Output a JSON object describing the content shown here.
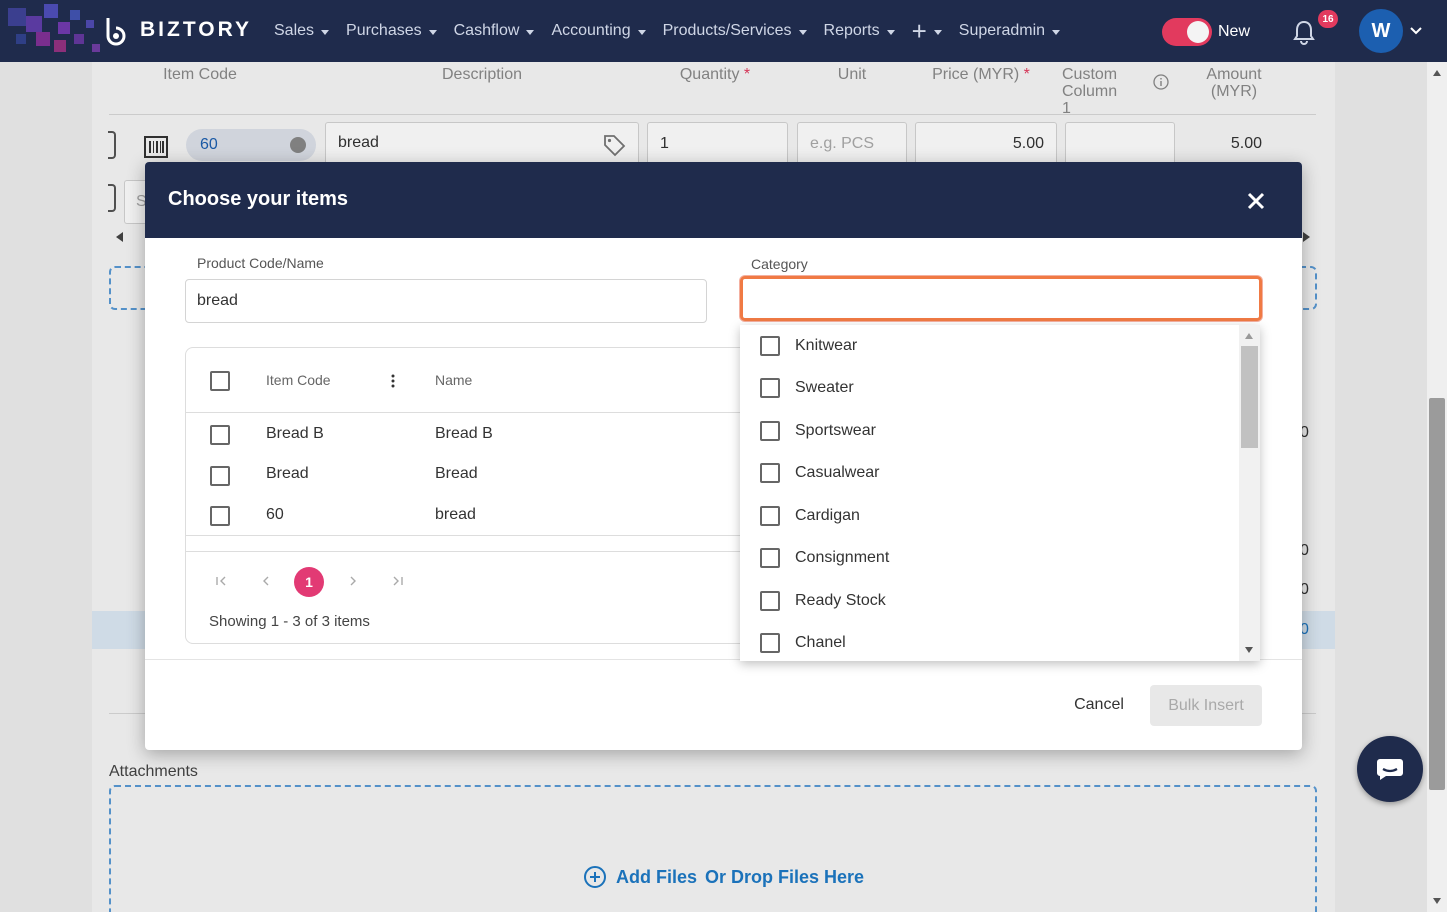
{
  "app": {
    "brand": "BIZTORY",
    "nav": [
      "Sales",
      "Purchases",
      "Cashflow",
      "Accounting",
      "Products/Services",
      "Reports"
    ],
    "superadmin": "Superadmin",
    "toggle_label": "New",
    "notification_count": "16",
    "avatar_initial": "W"
  },
  "background_table": {
    "headers": {
      "item_code": "Item Code",
      "description": "Description",
      "quantity": "Quantity",
      "unit": "Unit",
      "price": "Price (MYR)",
      "custom_column": "Custom Column 1",
      "amount": "Amount (MYR)"
    },
    "required_mark": "*",
    "row": {
      "item_code": "60",
      "description": "bread",
      "quantity": "1",
      "unit_placeholder": "e.g. PCS",
      "price": "5.00",
      "amount": "5.00"
    },
    "partial_glyph_s": "S",
    "partial_values": [
      "0",
      "0",
      "0",
      "0"
    ]
  },
  "attachments": {
    "label": "Attachments",
    "add_files": "Add Files",
    "drop_files": "Or Drop Files Here"
  },
  "modal": {
    "title": "Choose your items",
    "product_label": "Product Code/Name",
    "product_value": "bread",
    "category_label": "Category",
    "category_value": "",
    "grid": {
      "col_item_code": "Item Code",
      "col_name": "Name",
      "rows": [
        {
          "item_code": "Bread B",
          "name": "Bread B"
        },
        {
          "item_code": "Bread",
          "name": "Bread"
        },
        {
          "item_code": "60",
          "name": "bread"
        }
      ],
      "current_page": "1",
      "showing": "Showing 1 - 3 of 3 items"
    },
    "cancel": "Cancel",
    "bulk_insert": "Bulk Insert"
  },
  "category_dropdown": {
    "options": [
      "Knitwear",
      "Sweater",
      "Sportswear",
      "Casualwear",
      "Cardigan",
      "Consignment",
      "Ready Stock",
      "Chanel"
    ]
  },
  "colors": {
    "navy": "#1f2b4c",
    "accent_pink": "#e23a74",
    "focus_orange": "#f07a44",
    "link_blue": "#1d7ac6"
  }
}
